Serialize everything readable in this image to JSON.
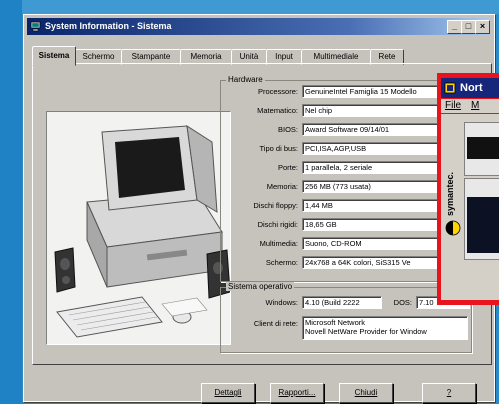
{
  "window": {
    "title": "System Information - Sistema",
    "controls": [
      "_",
      "□",
      "×"
    ]
  },
  "tabs": [
    {
      "label": "Sistema",
      "active": true
    },
    {
      "label": "Schermo"
    },
    {
      "label": "Stampante"
    },
    {
      "label": "Memoria"
    },
    {
      "label": "Unità"
    },
    {
      "label": "Input"
    },
    {
      "label": "Multimediale"
    },
    {
      "label": "Rete"
    }
  ],
  "hardware": {
    "group_title": "Hardware",
    "rows": [
      {
        "label": "Processore:",
        "value": "GenuineIntel Famiglia 15 Modello"
      },
      {
        "label": "Matematico:",
        "value": "Nel chip"
      },
      {
        "label": "BIOS:",
        "value": "Award Software 09/14/01"
      },
      {
        "label": "Tipo di bus:",
        "value": "PCI,ISA,AGP,USB"
      },
      {
        "label": "Porte:",
        "value": "1 parallela, 2 seriale"
      },
      {
        "label": "Memoria:",
        "value": "256 MB  (773 usata)"
      },
      {
        "label": "Dischi floppy:",
        "value": "1,44 MB"
      },
      {
        "label": "Dischi rigidi:",
        "value": "18,65 GB"
      },
      {
        "label": "Multimedia:",
        "value": "Suono, CD-ROM"
      },
      {
        "label": "Schermo:",
        "value": "24x768 a 64K colori, SiS315 Ve"
      }
    ]
  },
  "os": {
    "group_title": "Sistema operativo",
    "windows_label": "Windows:",
    "windows_value": "4.10 (Build 2222",
    "dos_label": "DOS:",
    "dos_value": "7.10",
    "clients_label": "Client di rete:",
    "clients": [
      "Microsoft Network",
      "Novell NetWare Provider for Window"
    ]
  },
  "buttons": {
    "details": "Dettagli",
    "report": "Rapporti...",
    "close": "Chiudi",
    "help": "?"
  },
  "norton": {
    "title": "Nort",
    "menu_file": "File",
    "menu_next": "M",
    "brand": "symantec."
  }
}
